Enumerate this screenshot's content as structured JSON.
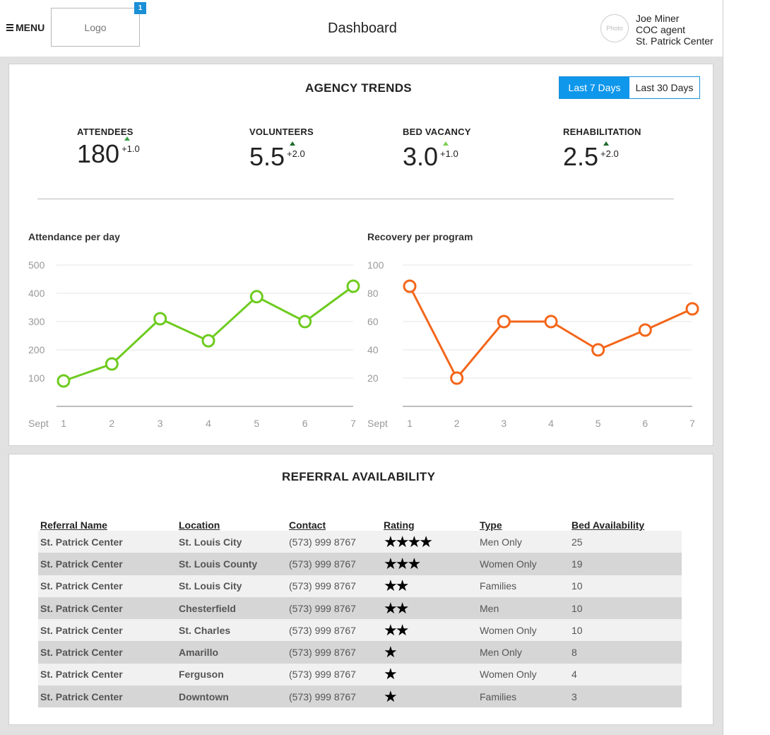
{
  "header": {
    "menu_label": "MENU",
    "logo_text": "Logo",
    "notification_count": "1",
    "title": "Dashboard",
    "avatar_text": "Photo",
    "user_name": "Joe Miner",
    "user_role": "COC agent",
    "user_org": "St. Patrick Center"
  },
  "trends": {
    "title": "AGENCY TRENDS",
    "range_options": [
      "Last 7 Days",
      "Last 30 Days"
    ],
    "selected_range": "Last 7 Days",
    "kpis": [
      {
        "label": "ATTENDEES",
        "value": "180",
        "delta": "+1.0"
      },
      {
        "label": "VOLUNTEERS",
        "value": "5.5",
        "delta": "+2.0"
      },
      {
        "label": "BED VACANCY",
        "value": "3.0",
        "delta": "+1.0"
      },
      {
        "label": "REHABILITATION",
        "value": "2.5",
        "delta": "+2.0"
      }
    ],
    "colors": {
      "attendance": "#6ecb1f",
      "recovery": "#f3661a",
      "accent": "#0f97ec"
    }
  },
  "chart_data": [
    {
      "type": "line",
      "title": "Attendance per day",
      "x": [
        1,
        2,
        3,
        4,
        5,
        6,
        7
      ],
      "xlabel": "Sept",
      "series": [
        {
          "values": [
            90,
            150,
            310,
            232,
            388,
            300,
            425
          ]
        }
      ],
      "yticks": [
        100,
        200,
        300,
        400,
        500
      ],
      "ylim": [
        0,
        500
      ],
      "grid": true
    },
    {
      "type": "line",
      "title": "Recovery per program",
      "x": [
        1,
        2,
        3,
        4,
        5,
        6,
        7
      ],
      "xlabel": "Sept",
      "series": [
        {
          "values": [
            85,
            20,
            60,
            60,
            40,
            54,
            69
          ]
        }
      ],
      "yticks": [
        20,
        40,
        60,
        80,
        100
      ],
      "ylim": [
        0,
        100
      ],
      "grid": true
    }
  ],
  "referral": {
    "title": "REFERRAL AVAILABILITY",
    "columns": [
      "Referral Name",
      "Location",
      "Contact",
      "Rating",
      "Type",
      "Bed Availability"
    ],
    "rows": [
      {
        "name": "St. Patrick Center",
        "location": "St. Louis City",
        "contact": "(573) 999 8767",
        "rating": 4,
        "type": "Men Only",
        "beds": "25"
      },
      {
        "name": "St. Patrick Center",
        "location": "St. Louis County",
        "contact": "(573) 999 8767",
        "rating": 3,
        "type": "Women Only",
        "beds": "19"
      },
      {
        "name": "St. Patrick Center",
        "location": "St. Louis City",
        "contact": "(573) 999 8767",
        "rating": 2,
        "type": "Families",
        "beds": "10"
      },
      {
        "name": "St. Patrick Center",
        "location": "Chesterfield",
        "contact": "(573) 999 8767",
        "rating": 2,
        "type": "Men",
        "beds": "10"
      },
      {
        "name": "St. Patrick Center",
        "location": "St. Charles",
        "contact": "(573) 999 8767",
        "rating": 2,
        "type": "Women Only",
        "beds": "10"
      },
      {
        "name": "St. Patrick Center",
        "location": "Amarillo",
        "contact": "(573) 999 8767",
        "rating": 1,
        "type": "Men Only",
        "beds": "8"
      },
      {
        "name": "St. Patrick Center",
        "location": "Ferguson",
        "contact": "(573) 999 8767",
        "rating": 1,
        "type": "Women Only",
        "beds": "4"
      },
      {
        "name": "St. Patrick Center",
        "location": "Downtown",
        "contact": "(573) 999 8767",
        "rating": 1,
        "type": "Families",
        "beds": "3"
      }
    ]
  }
}
